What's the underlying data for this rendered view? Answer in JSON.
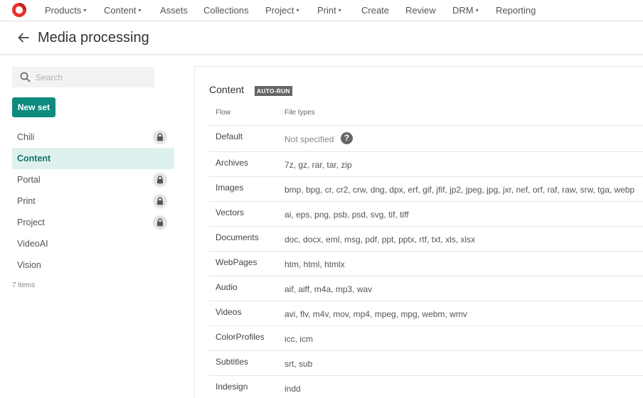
{
  "nav": {
    "items": [
      {
        "label": "Products",
        "dropdown": true
      },
      {
        "label": "Content",
        "dropdown": true
      },
      {
        "label": "Assets",
        "dropdown": false
      },
      {
        "label": "Collections",
        "dropdown": false
      },
      {
        "label": "Project",
        "dropdown": true
      },
      {
        "label": "Print",
        "dropdown": true
      },
      {
        "label": "Create",
        "dropdown": false
      },
      {
        "label": "Review",
        "dropdown": false
      },
      {
        "label": "DRM",
        "dropdown": true
      },
      {
        "label": "Reporting",
        "dropdown": false
      }
    ],
    "caret": "▾"
  },
  "header": {
    "title": "Media processing"
  },
  "sidebar": {
    "search_placeholder": "Search",
    "new_set_label": "New set",
    "sets": [
      {
        "label": "Chili",
        "locked": true,
        "active": false
      },
      {
        "label": "Content",
        "locked": false,
        "active": true
      },
      {
        "label": "Portal",
        "locked": true,
        "active": false
      },
      {
        "label": "Print",
        "locked": true,
        "active": false
      },
      {
        "label": "Project",
        "locked": true,
        "active": false
      },
      {
        "label": "VideoAI",
        "locked": false,
        "active": false
      },
      {
        "label": "Vision",
        "locked": false,
        "active": false
      }
    ],
    "count_label": "7 items"
  },
  "content": {
    "title": "Content",
    "badge": "AUTO-RUN",
    "col_flow": "Flow",
    "col_types": "File types",
    "rows": [
      {
        "flow": "Default",
        "types": "Not specified",
        "help": "?"
      },
      {
        "flow": "Archives",
        "types": "7z, gz, rar, tar, zip"
      },
      {
        "flow": "Images",
        "types": "bmp, bpg, cr, cr2, crw, dng, dpx, erf, gif, jfif, jp2, jpeg, jpg, jxr, nef, orf, raf, raw, srw, tga, webp"
      },
      {
        "flow": "Vectors",
        "types": "ai, eps, png, psb, psd, svg, tif, tiff"
      },
      {
        "flow": "Documents",
        "types": "doc, docx, eml, msg, pdf, ppt, pptx, rtf, txt, xls, xlsx"
      },
      {
        "flow": "WebPages",
        "types": "htm, html, htmlx"
      },
      {
        "flow": "Audio",
        "types": "aif, aiff, m4a, mp3, wav"
      },
      {
        "flow": "Videos",
        "types": "avi, flv, m4v, mov, mp4, mpeg, mpg, webm, wmv"
      },
      {
        "flow": "ColorProfiles",
        "types": "icc, icm"
      },
      {
        "flow": "Subtitles",
        "types": "srt, sub"
      },
      {
        "flow": "Indesign",
        "types": "indd"
      }
    ]
  },
  "colors": {
    "accent": "#0f8a7e",
    "active_bg": "#dff1ef",
    "logo": "#e8322a"
  }
}
